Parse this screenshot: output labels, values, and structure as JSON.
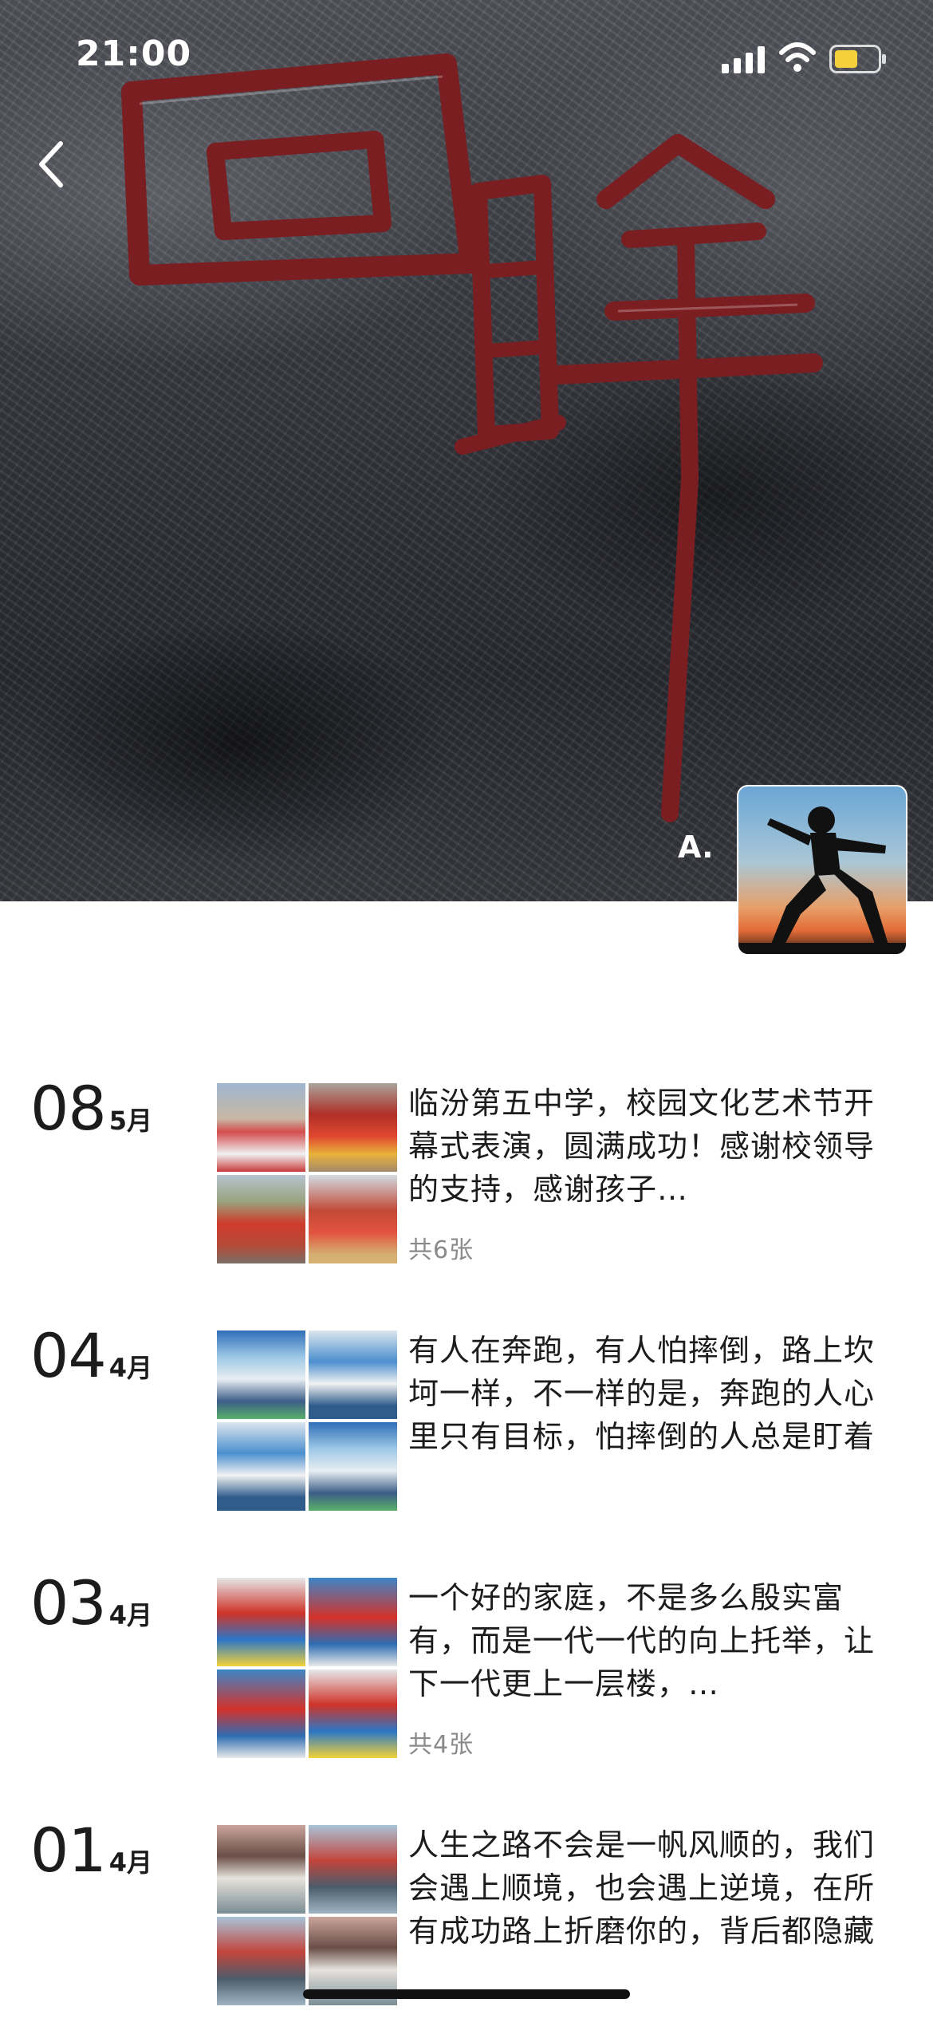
{
  "status_bar": {
    "time": "21:00",
    "icons": [
      "signal-icon",
      "wifi-icon",
      "battery-icon"
    ]
  },
  "cover": {
    "calligraphy_text": "回眸",
    "watermark": "A.",
    "back_icon": "chevron-left-icon"
  },
  "posts": [
    {
      "day": "08",
      "month": "5月",
      "text": "临汾第五中学，校园文化艺术节开幕式表演，圆满成功！感谢校领导的支持，感谢孩子…",
      "count": "共6张",
      "thumbs": [
        "sc-stage",
        "sc-red",
        "sc-yard",
        "sc-yard2"
      ]
    },
    {
      "day": "04",
      "month": "4月",
      "text": "有人在奔跑，有人怕摔倒，路上坎坷一样，不一样的是，奔跑的人心里只有目标，怕摔倒的人总是盯着路上的荆棘。",
      "count": "",
      "thumbs": [
        "sc-gym",
        "sc-gym2",
        "sc-gym2",
        "sc-gym"
      ]
    },
    {
      "day": "03",
      "month": "4月",
      "text": "一个好的家庭，不是多么殷实富有，而是一代一代的向上托举，让下一代更上一层楼，…",
      "count": "共4张",
      "thumbs": [
        "sc-mat",
        "sc-mat2",
        "sc-mat2",
        "sc-mat"
      ]
    },
    {
      "day": "01",
      "month": "4月",
      "text": "人生之路不会是一帆风顺的，我们会遇上顺境，也会遇上逆境，在所有成功路上折磨你的，背后都隐藏着激励你奋…",
      "count": "",
      "thumbs": [
        "sc-court",
        "sc-court2",
        "sc-court2",
        "sc-court"
      ]
    }
  ]
}
